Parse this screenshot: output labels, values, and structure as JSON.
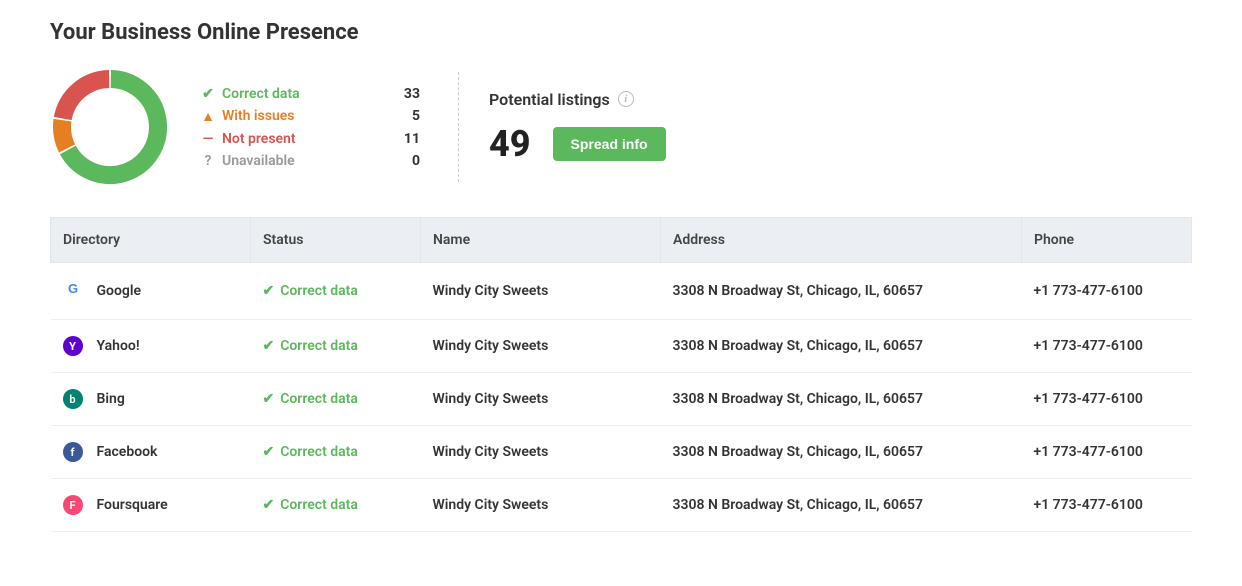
{
  "title": "Your Business Online Presence",
  "chart_data": {
    "type": "pie",
    "title": "",
    "categories": [
      "Correct data",
      "With issues",
      "Not present",
      "Unavailable"
    ],
    "values": [
      33,
      5,
      11,
      0
    ],
    "colors": [
      "#5cb85c",
      "#e67e22",
      "#d9534f",
      "#999999"
    ]
  },
  "legend": {
    "correct": {
      "label": "Correct data",
      "count": "33"
    },
    "issues": {
      "label": "With issues",
      "count": "5"
    },
    "notpresent": {
      "label": "Not present",
      "count": "11"
    },
    "unavail": {
      "label": "Unavailable",
      "count": "0"
    }
  },
  "potential": {
    "heading": "Potential listings",
    "count": "49",
    "button": "Spread info"
  },
  "table": {
    "headers": {
      "directory": "Directory",
      "status": "Status",
      "name": "Name",
      "address": "Address",
      "phone": "Phone"
    },
    "rows": [
      {
        "directory": "Google",
        "status": "Correct data",
        "name": "Windy City Sweets",
        "address": "3308 N Broadway St, Chicago, IL, 60657",
        "phone": "+1 773-477-6100",
        "icon": "google"
      },
      {
        "directory": "Yahoo!",
        "status": "Correct data",
        "name": "Windy City Sweets",
        "address": "3308 N Broadway St, Chicago, IL, 60657",
        "phone": "+1 773-477-6100",
        "icon": "yahoo"
      },
      {
        "directory": "Bing",
        "status": "Correct data",
        "name": "Windy City Sweets",
        "address": "3308 N Broadway St, Chicago, IL, 60657",
        "phone": "+1 773-477-6100",
        "icon": "bing"
      },
      {
        "directory": "Facebook",
        "status": "Correct data",
        "name": "Windy City Sweets",
        "address": "3308 N Broadway St, Chicago, IL, 60657",
        "phone": "+1 773-477-6100",
        "icon": "facebook"
      },
      {
        "directory": "Foursquare",
        "status": "Correct data",
        "name": "Windy City Sweets",
        "address": "3308 N Broadway St, Chicago, IL, 60657",
        "phone": "+1 773-477-6100",
        "icon": "foursquare"
      }
    ]
  }
}
